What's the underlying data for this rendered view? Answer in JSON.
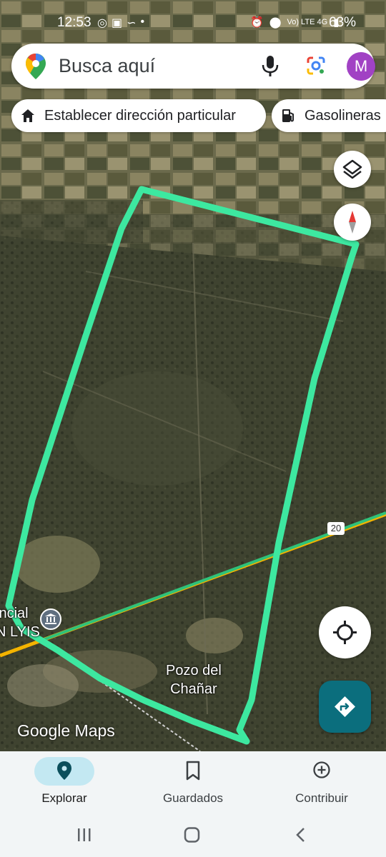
{
  "status_bar": {
    "time": "12:53",
    "notification_icons": [
      "whatsapp-icon",
      "gallery-icon",
      "tiktok-icon",
      "dot-icon"
    ],
    "network": "Vo) LTE 4G",
    "battery": "63%"
  },
  "search": {
    "placeholder": "Busca aquí",
    "avatar_letter": "M",
    "avatar_color": "#a142c4"
  },
  "chips": {
    "home_label": "Establecer dirección particular",
    "gas_label": "Gasolineras"
  },
  "map": {
    "place_label_line1": "Pozo del",
    "place_label_line2": "Chañar",
    "province_label_line1": "incial",
    "province_label_line2": "N LYIS",
    "road_number": "20",
    "watermark": "Google Maps",
    "boundary_color": "#3de8a0"
  },
  "bottom_nav": {
    "items": [
      {
        "label": "Explorar",
        "icon": "location-pin-icon",
        "active": true
      },
      {
        "label": "Guardados",
        "icon": "bookmark-icon",
        "active": false
      },
      {
        "label": "Contribuir",
        "icon": "add-circle-icon",
        "active": false
      }
    ]
  },
  "colors": {
    "accent": "#0b6e7d",
    "nav_active": "#c3e8f2"
  }
}
